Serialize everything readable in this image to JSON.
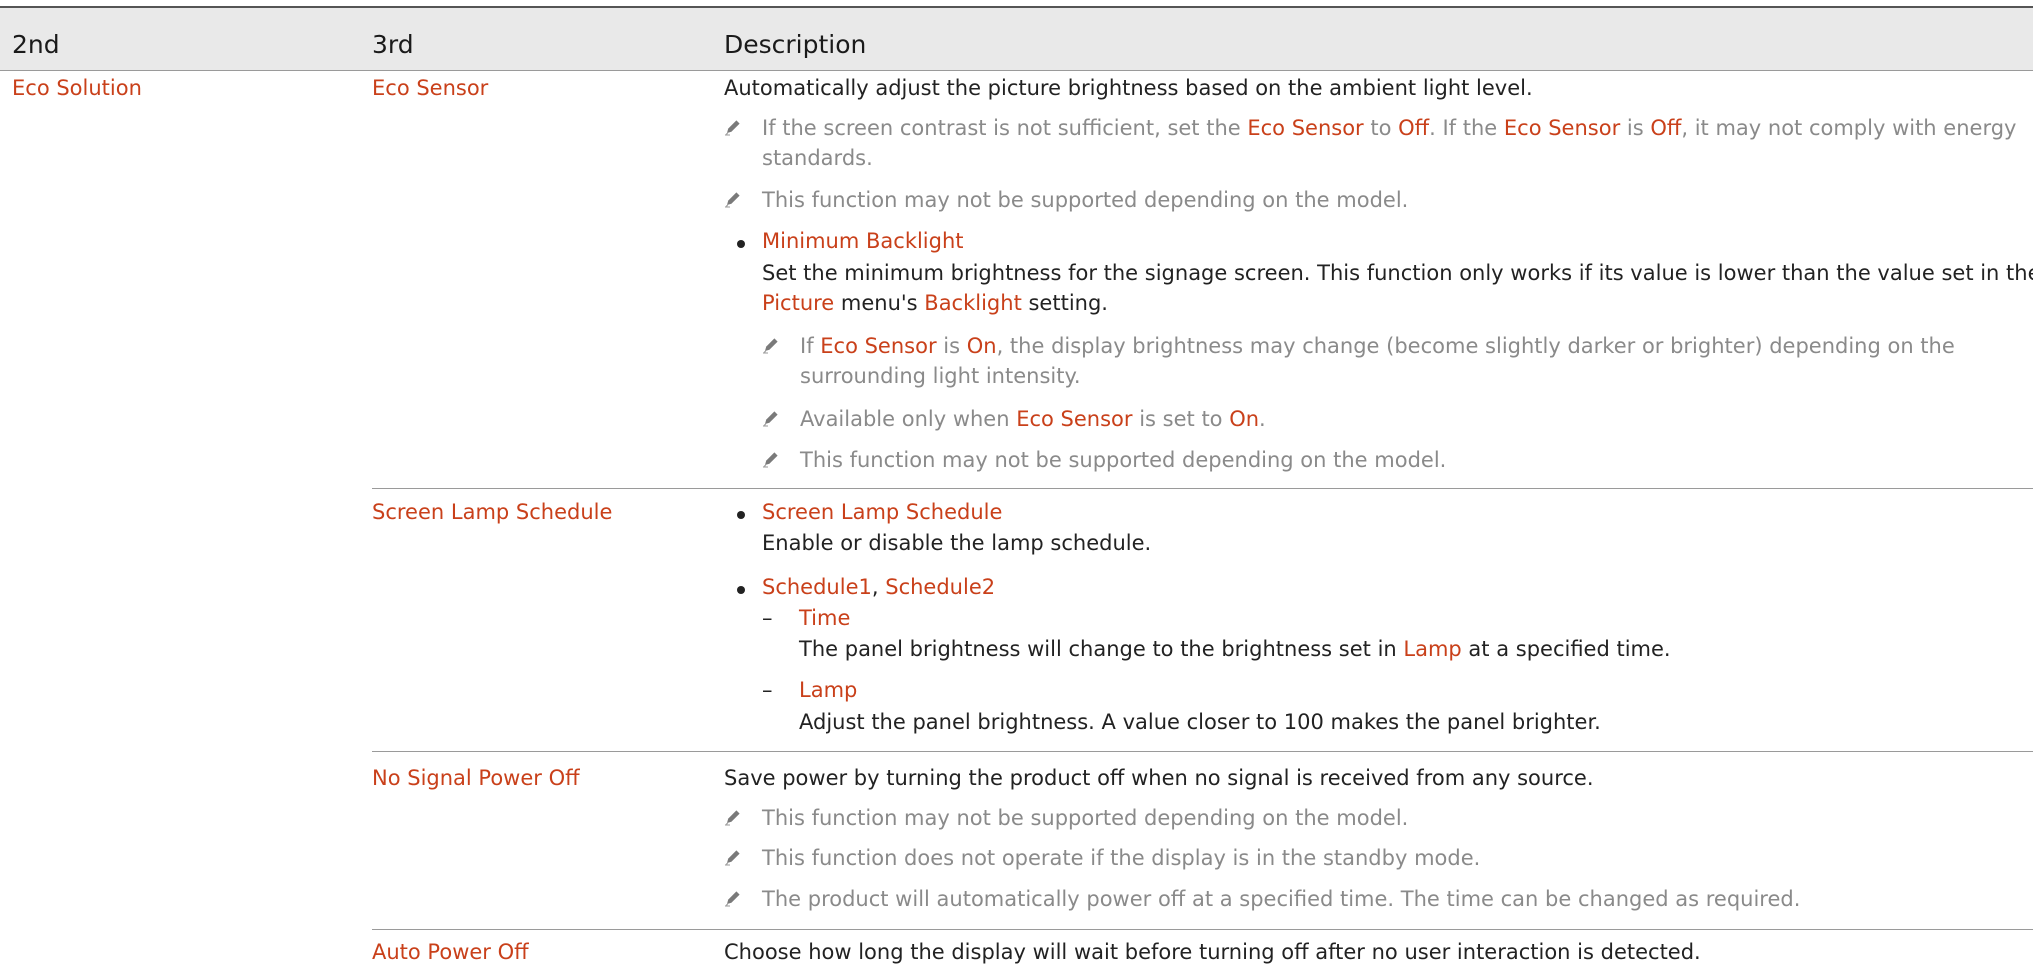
{
  "header": {
    "col1": "2nd",
    "col2": "3rd",
    "col3": "Description"
  },
  "eco_solution": "Eco Solution",
  "eco_sensor": {
    "label": "Eco Sensor",
    "desc": "Automatically adjust the picture brightness based on the ambient light level.",
    "note1_a": "If the screen contrast is not sufficient, set the ",
    "note1_b": "Eco Sensor",
    "note1_c": " to ",
    "note1_d": "Off",
    "note1_e": ". If the ",
    "note1_f": "Eco Sensor",
    "note1_g": " is ",
    "note1_h": "Off",
    "note1_i": ", it may not comply with energy",
    "note1_line2": "standards.",
    "note2": "This function may not be supported depending on the model.",
    "bullet_title": "Minimum Backlight",
    "bullet_desc1": "Set the minimum brightness for the signage screen. This function only works if its value is lower than the value set in the",
    "bullet_desc2_a": "Picture",
    "bullet_desc2_b": " menu's ",
    "bullet_desc2_c": "Backlight",
    "bullet_desc2_d": " setting.",
    "sub1_a": "If ",
    "sub1_b": "Eco Sensor",
    "sub1_c": " is ",
    "sub1_d": "On",
    "sub1_e": ", the display brightness may change (become slightly darker or brighter) depending on the",
    "sub1_line2": "surrounding light intensity.",
    "sub2_a": "Available only when ",
    "sub2_b": "Eco Sensor",
    "sub2_c": " is set to ",
    "sub2_d": "On",
    "sub2_e": ".",
    "sub3": "This function may not be supported depending on the model."
  },
  "screen_lamp": {
    "label": "Screen Lamp Schedule",
    "b1_title": "Screen Lamp Schedule",
    "b1_desc": "Enable or disable the lamp schedule.",
    "b2_title_a": "Schedule1",
    "b2_title_b": ", ",
    "b2_title_c": "Schedule2",
    "time_title": "Time",
    "time_desc_a": "The panel brightness will change to the brightness set in ",
    "time_desc_b": "Lamp",
    "time_desc_c": " at a specified time.",
    "lamp_title": "Lamp",
    "lamp_desc": "Adjust the panel brightness. A value closer to 100 makes the panel brighter.",
    "dash": "–"
  },
  "no_signal": {
    "label": "No Signal Power Off",
    "desc": "Save power by turning the product off when no signal is received from any source.",
    "note1": "This function may not be supported depending on the model.",
    "note2": "This function does not operate if the display is in the standby mode.",
    "note3": "The product will automatically power off at a specified time. The time can be changed as required."
  },
  "auto_power": {
    "label": "Auto Power Off",
    "desc": "Choose how long the display will wait before turning off after no user interaction is detected."
  },
  "colors": {
    "accent": "#c9401a",
    "note": "#8a8a8a",
    "header_bg": "#e9e9e9"
  },
  "icons": {
    "note": "pencil-icon",
    "bullet": "bullet-icon"
  }
}
